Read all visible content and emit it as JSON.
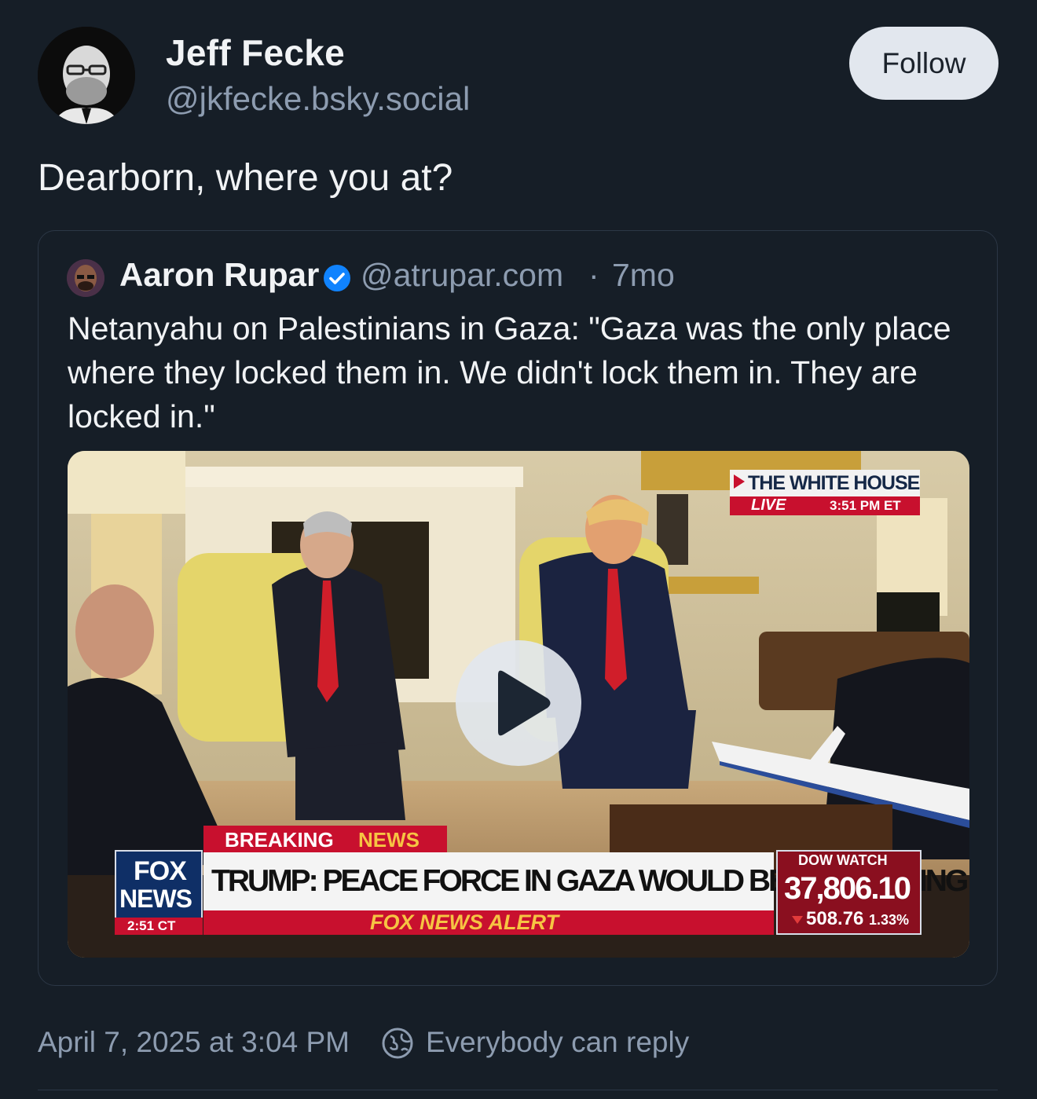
{
  "post": {
    "author_name": "Jeff Fecke",
    "author_handle": "@jkfecke.bsky.social",
    "follow_label": "Follow",
    "text": "Dearborn, where you at?"
  },
  "quote": {
    "author_name": "Aaron Rupar",
    "author_handle": "@atrupar.com",
    "separator": "·",
    "time": "7mo",
    "text": "Netanyahu on Palestinians in Gaza: \"Gaza was the only place where they locked them in. We didn't lock them in. They are locked in.\"",
    "video": {
      "overlay": {
        "location_label": "THE WHITE HOUSE",
        "live_label": "LIVE",
        "live_time": "3:51 PM ET",
        "breaking_label": "BREAKING",
        "news_label": "NEWS",
        "headline": "TRUMP: PEACE FORCE IN GAZA WOULD BE GOOD THING",
        "alert_label": "FOX NEWS ALERT",
        "network_line1": "FOX",
        "network_line2": "NEWS",
        "network_time": "2:51 CT",
        "dow_label": "DOW WATCH",
        "dow_value": "37,806.10",
        "dow_change": "508.76",
        "dow_percent": "1.33%"
      }
    }
  },
  "footer": {
    "date": "April 7, 2025 at 3:04 PM",
    "reply_setting": "Everybody can reply"
  },
  "colors": {
    "background": "#161e27",
    "muted_text": "#8d9cb0",
    "verified": "#1083fe",
    "follow_bg": "#e2e7ee"
  }
}
